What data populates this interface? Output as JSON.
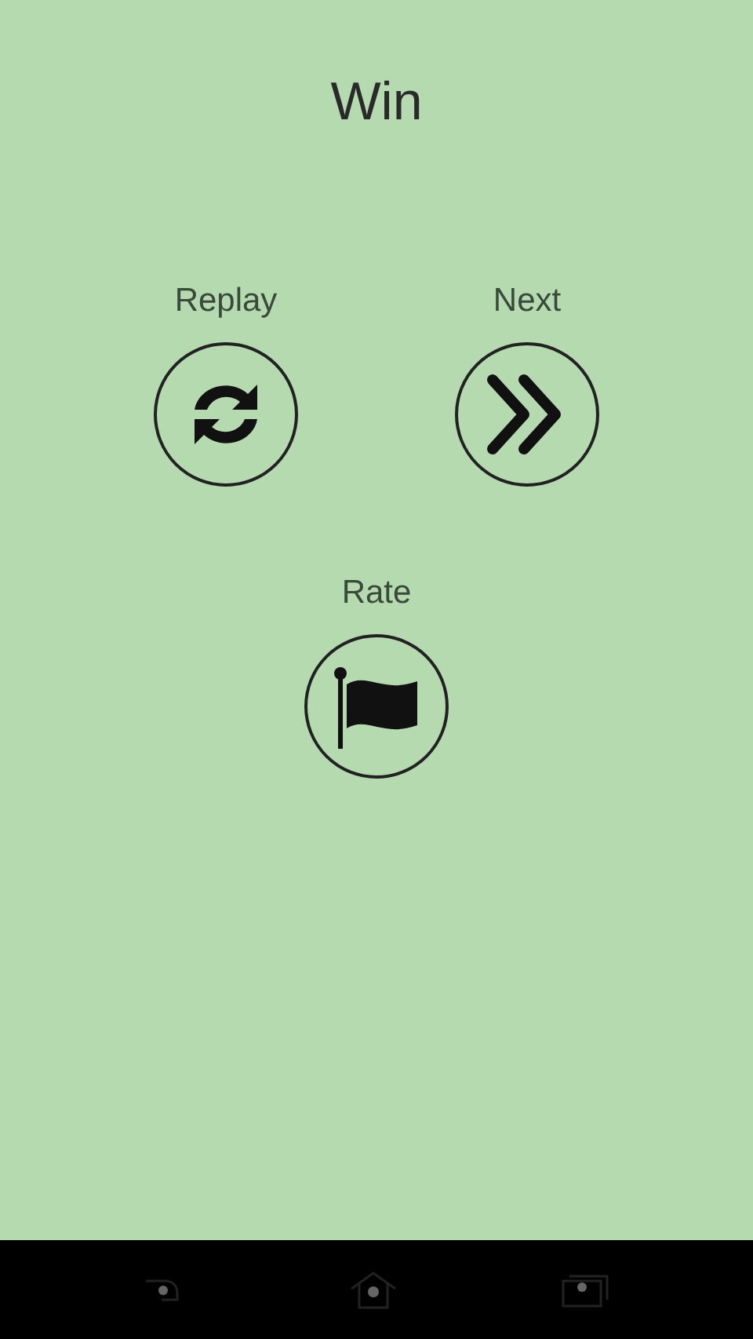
{
  "title": "Win",
  "actions": [
    {
      "label": "Replay",
      "kind": "replay"
    },
    {
      "label": "Next",
      "kind": "next"
    },
    {
      "label": "Rate",
      "kind": "rate"
    }
  ],
  "nav_bar": [
    {
      "kind": "back"
    },
    {
      "kind": "home"
    },
    {
      "kind": "recents"
    }
  ]
}
